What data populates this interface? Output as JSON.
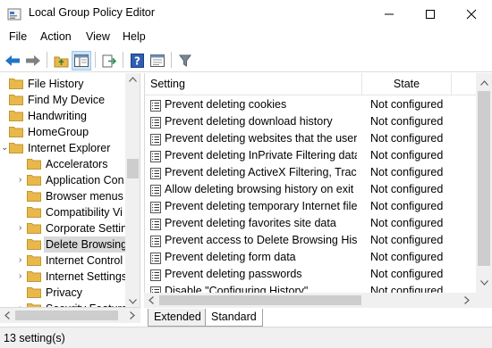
{
  "window": {
    "title": "Local Group Policy Editor"
  },
  "menu": [
    "File",
    "Action",
    "View",
    "Help"
  ],
  "tree": [
    {
      "label": "File History",
      "expander": ""
    },
    {
      "label": "Find My Device",
      "expander": ""
    },
    {
      "label": "Handwriting",
      "expander": ""
    },
    {
      "label": "HomeGroup",
      "expander": ""
    },
    {
      "label": "Internet Explorer",
      "expander": "⌄"
    },
    {
      "label": "Accelerators",
      "expander": ""
    },
    {
      "label": "Application Con",
      "expander": "›"
    },
    {
      "label": "Browser menus",
      "expander": ""
    },
    {
      "label": "Compatibility Vi",
      "expander": ""
    },
    {
      "label": "Corporate Settin",
      "expander": "›"
    },
    {
      "label": "Delete Browsing",
      "expander": ""
    },
    {
      "label": "Internet Control",
      "expander": "›"
    },
    {
      "label": "Internet Settings",
      "expander": "›"
    },
    {
      "label": "Privacy",
      "expander": ""
    },
    {
      "label": "Security Feature",
      "expander": "›"
    }
  ],
  "columns": {
    "setting": "Setting",
    "state": "State"
  },
  "rows": [
    {
      "name": "Prevent deleting cookies",
      "state": "Not configured"
    },
    {
      "name": "Prevent deleting download history",
      "state": "Not configured"
    },
    {
      "name": "Prevent deleting websites that the user ...",
      "state": "Not configured"
    },
    {
      "name": "Prevent deleting InPrivate Filtering data",
      "state": "Not configured"
    },
    {
      "name": "Prevent deleting ActiveX Filtering, Track...",
      "state": "Not configured"
    },
    {
      "name": "Allow deleting browsing history on exit",
      "state": "Not configured"
    },
    {
      "name": "Prevent deleting temporary Internet files",
      "state": "Not configured"
    },
    {
      "name": "Prevent deleting favorites site data",
      "state": "Not configured"
    },
    {
      "name": "Prevent access to Delete Browsing Hist...",
      "state": "Not configured"
    },
    {
      "name": "Prevent deleting form data",
      "state": "Not configured"
    },
    {
      "name": "Prevent deleting passwords",
      "state": "Not configured"
    },
    {
      "name": "Disable \"Configuring History\"",
      "state": "Not configured"
    }
  ],
  "tabs": [
    "Extended",
    "Standard"
  ],
  "status": "13 setting(s)",
  "icons": {
    "back": "back-arrow-icon",
    "forward": "forward-arrow-icon",
    "up": "up-folder-icon",
    "console_tree": "show-hide-tree-icon",
    "export": "export-list-icon",
    "help": "help-icon",
    "properties": "properties-icon",
    "filter": "filter-icon"
  },
  "colors": {
    "selection": "#d9d9d9",
    "folder": "#e8b84a",
    "toolbar_active": "#cce4f7",
    "back_arrow": "#1f76c6"
  }
}
